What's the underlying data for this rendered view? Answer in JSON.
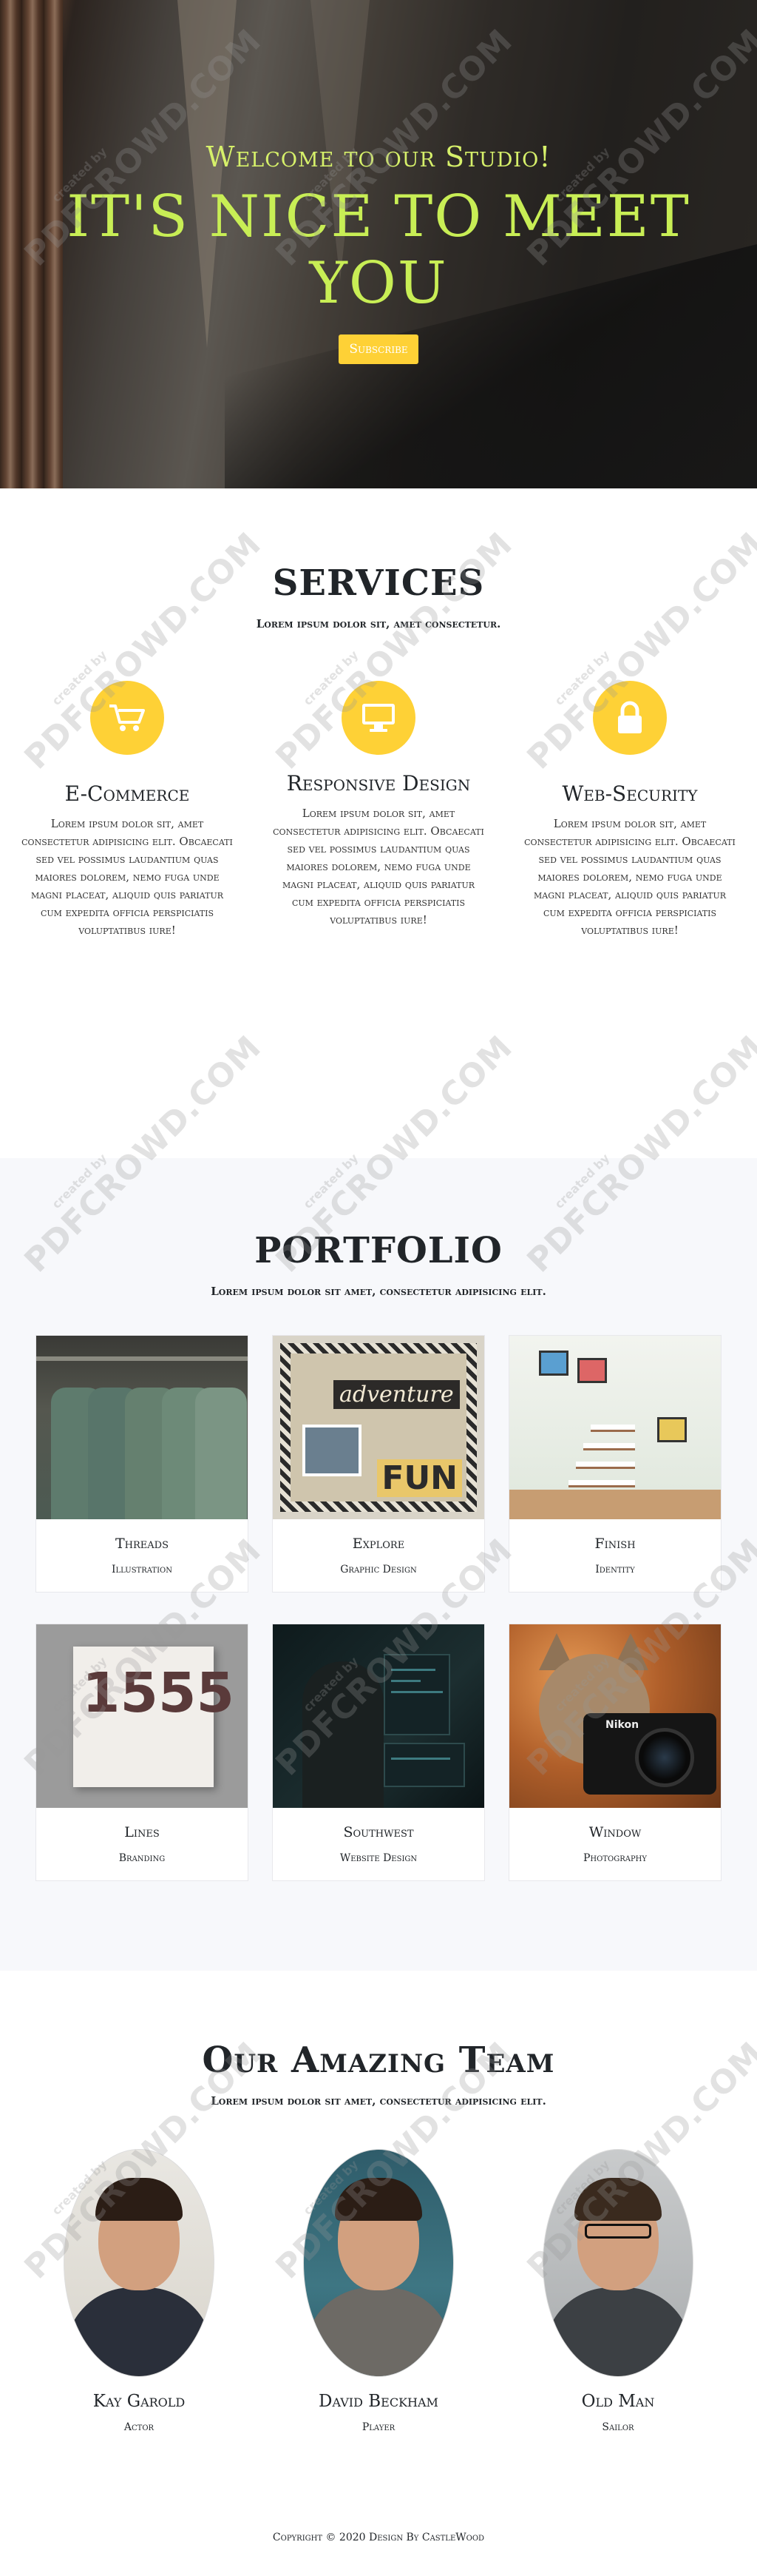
{
  "hero": {
    "subheading": "Welcome to our Studio!",
    "heading": "IT'S NICE TO MEET YOU",
    "button_label": "Subscribe"
  },
  "services": {
    "heading": "SERVICES",
    "subheading": "Lorem ipsum dolor sit, amet consectetur.",
    "items": [
      {
        "icon": "shopping-cart-icon",
        "title": "E-Commerce",
        "text": "Lorem ipsum dolor sit, amet consectetur adipisicing elit. Obcaecati sed vel possimus laudantium quas maiores dolorem, nemo fuga unde magni placeat, aliquid quis pariatur cum expedita officia perspiciatis voluptatibus iure!"
      },
      {
        "icon": "laptop-icon",
        "title": "Responsive Design",
        "text": "Lorem ipsum dolor sit, amet consectetur adipisicing elit. Obcaecati sed vel possimus laudantium quas maiores dolorem, nemo fuga unde magni placeat, aliquid quis pariatur cum expedita officia perspiciatis voluptatibus iure!"
      },
      {
        "icon": "lock-icon",
        "title": "Web-Security",
        "text": "Lorem ipsum dolor sit, amet consectetur adipisicing elit. Obcaecati sed vel possimus laudantium quas maiores dolorem, nemo fuga unde magni placeat, aliquid quis pariatur cum expedita officia perspiciatis voluptatibus iure!"
      }
    ],
    "icon_color": "#fed136"
  },
  "portfolio": {
    "heading": "PORTFOLIO",
    "subheading": "Lorem ipsum dolor sit amet, consectetur adipisicing elit.",
    "items": [
      {
        "title": "Threads",
        "category": "Illustration"
      },
      {
        "title": "Explore",
        "category": "Graphic Design"
      },
      {
        "title": "Finish",
        "category": "Identity"
      },
      {
        "title": "Lines",
        "category": "Branding"
      },
      {
        "title": "Southwest",
        "category": "Website Design"
      },
      {
        "title": "Window",
        "category": "Photography"
      }
    ],
    "thumb_text": {
      "adventure": "adventure",
      "fun": "FUN",
      "digits": "1555",
      "camera_brand": "Nikon"
    }
  },
  "team": {
    "heading": "Our Amazing Team",
    "subheading": "Lorem ipsum dolor sit amet, consectetur adipisicing elit.",
    "members": [
      {
        "name": "Kay Garold",
        "role": "Actor"
      },
      {
        "name": "David Beckham",
        "role": "Player"
      },
      {
        "name": "Old Man",
        "role": "Sailor"
      }
    ]
  },
  "footer": {
    "copyright": "Copyright © 2020 Design By CastleWood"
  },
  "watermark": {
    "text": "PDFCROWD.COM",
    "small": "created by"
  },
  "colors": {
    "accent": "#fed136",
    "hero_text": "#c8ee55"
  }
}
